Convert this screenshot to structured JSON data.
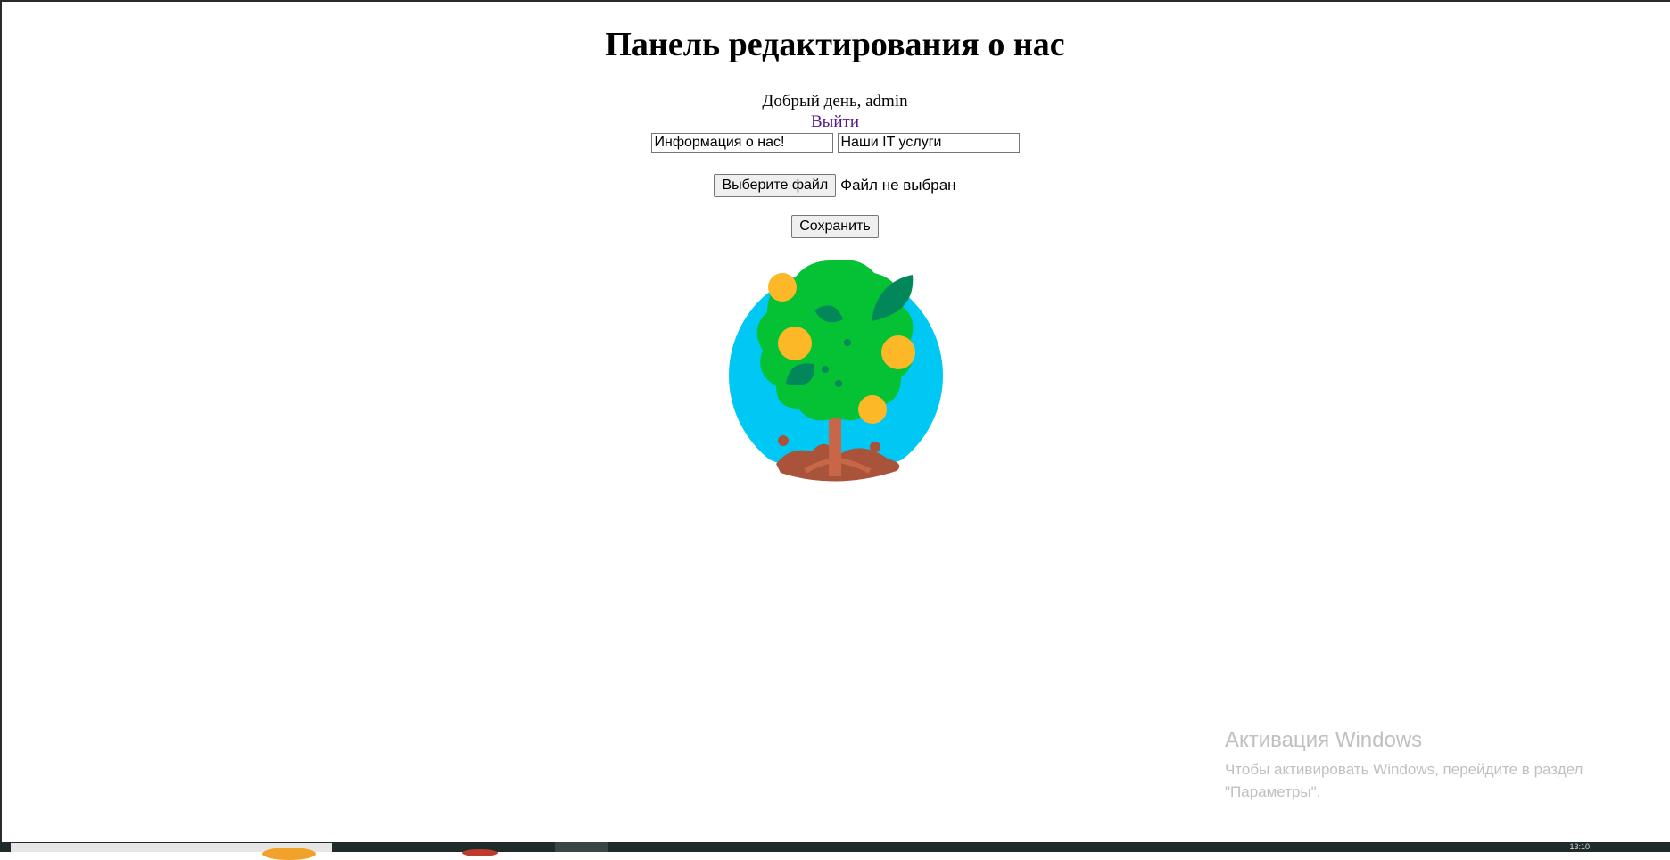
{
  "page": {
    "title": "Панель редактирования о нас",
    "greeting": "Добрый день, admin",
    "logout_label": "Выйти"
  },
  "form": {
    "field_about_value": "Информация о нас!",
    "field_services_value": "Наши IT услуги",
    "file_button_label": "Выберите файл",
    "file_status": "Файл не выбран",
    "save_label": "Сохранить"
  },
  "image": {
    "icon": "money-tree-icon"
  },
  "watermark": {
    "title": "Активация Windows",
    "text": "Чтобы активировать Windows, перейдите в раздел \"Параметры\"."
  },
  "taskbar": {
    "clock": "13:10"
  },
  "colors": {
    "link": "#551a8b",
    "sky": "#00c8f5",
    "leaves": "#05c134",
    "fruit": "#fcb827",
    "soil": "#a9533a"
  }
}
